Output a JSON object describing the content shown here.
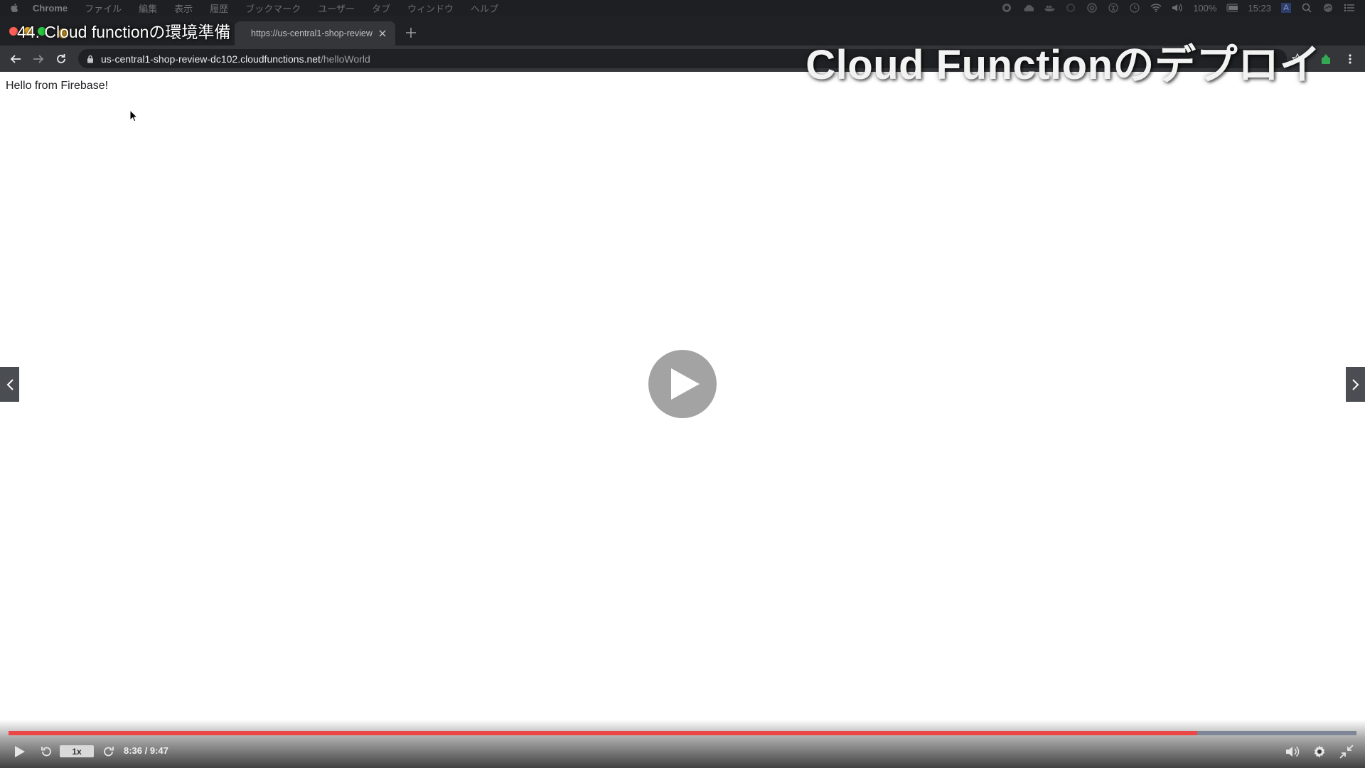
{
  "menubar": {
    "app": "Chrome",
    "items": [
      "ファイル",
      "編集",
      "表示",
      "履歴",
      "ブックマーク",
      "ユーザー",
      "タブ",
      "ウィンドウ",
      "ヘルプ"
    ],
    "battery": "100%",
    "clock": "15:23",
    "input_mode": "A"
  },
  "browser": {
    "active_tab_title": "https://us-central1-shop-review",
    "omnibox": {
      "host": "us-central1-shop-review-dc102.cloudfunctions.net",
      "path": "/helloWorld"
    }
  },
  "page": {
    "body_text": "Hello from Firebase!"
  },
  "video": {
    "lecture_title": "44. Cloud functionの環境準備",
    "slide_caption": "Cloud Functionのデプロイ",
    "speed": "1x",
    "time": "8:36 / 9:47",
    "progress": 0.882
  },
  "colors": {
    "progress_fill": "#ec4747",
    "progress_track": "#7e8596"
  }
}
